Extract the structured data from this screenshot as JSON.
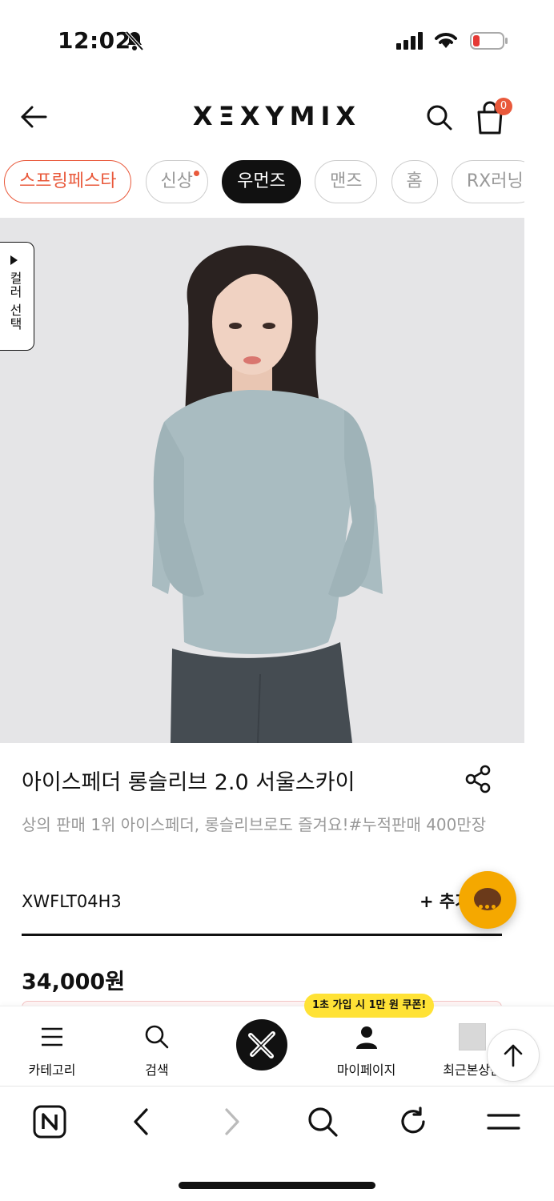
{
  "status": {
    "time": "12:02",
    "icons": [
      "bell-slash-icon",
      "cellular-signal-icon",
      "wifi-icon",
      "battery-low-icon"
    ]
  },
  "header": {
    "logo": "XΞXYMIX",
    "cart_count": "0",
    "icons": [
      "back-arrow-icon",
      "search-icon",
      "shopping-bag-icon"
    ]
  },
  "categories": [
    {
      "label": "스프링페스타",
      "style": "promo"
    },
    {
      "label": "신상",
      "style": "new"
    },
    {
      "label": "우먼즈",
      "style": "active"
    },
    {
      "label": "맨즈",
      "style": "normal"
    },
    {
      "label": "홈",
      "style": "normal"
    },
    {
      "label": "RX러닝",
      "style": "normal"
    }
  ],
  "color_select": {
    "label": "컬러 선택"
  },
  "product": {
    "title": "아이스페더 롱슬리브 2.0 서울스카이",
    "description": "상의 판매 1위 아이스페더, 롱슬리브로도 즐겨요!#누적판매 400만장",
    "sku": "XWFLT04H3",
    "add_label": "+ 추가",
    "price": "34,000원"
  },
  "app_nav": {
    "items": [
      {
        "label": "카테고리",
        "icon": "menu-icon"
      },
      {
        "label": "검색",
        "icon": "search-icon"
      },
      {
        "label": "",
        "icon": "brand-x-icon"
      },
      {
        "label": "마이페이지",
        "icon": "person-icon"
      },
      {
        "label": "최근본상품",
        "icon": "recent-thumb-icon"
      }
    ],
    "coupon_tip": "1초 가입 시 1만 원 쿠폰!"
  },
  "browser": {
    "icons": [
      "naver-n-icon",
      "back-chevron-icon",
      "forward-chevron-icon",
      "search-icon",
      "refresh-icon",
      "menu-icon"
    ]
  },
  "colors": {
    "accent": "#e9593b",
    "chat": "#f5a800",
    "coupon": "#ffe236",
    "product_bg": "#e5e5e7",
    "shirt": "#a9bcc1"
  }
}
